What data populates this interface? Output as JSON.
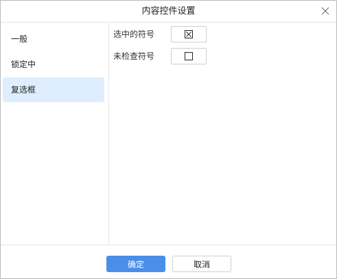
{
  "dialog": {
    "title": "内容控件设置"
  },
  "sidebar": {
    "items": [
      {
        "label": "一般"
      },
      {
        "label": "锁定中"
      },
      {
        "label": "复选框"
      }
    ],
    "active_index": 2
  },
  "checkbox_settings": {
    "checked_symbol_label": "选中的符号",
    "unchecked_symbol_label": "未检查符号",
    "checked_symbol_icon": "checkbox-crossed-icon",
    "unchecked_symbol_icon": "checkbox-empty-icon"
  },
  "footer": {
    "ok_label": "确定",
    "cancel_label": "取消"
  },
  "colors": {
    "accent": "#4a8ee8",
    "active_item_bg": "#deeefe"
  }
}
